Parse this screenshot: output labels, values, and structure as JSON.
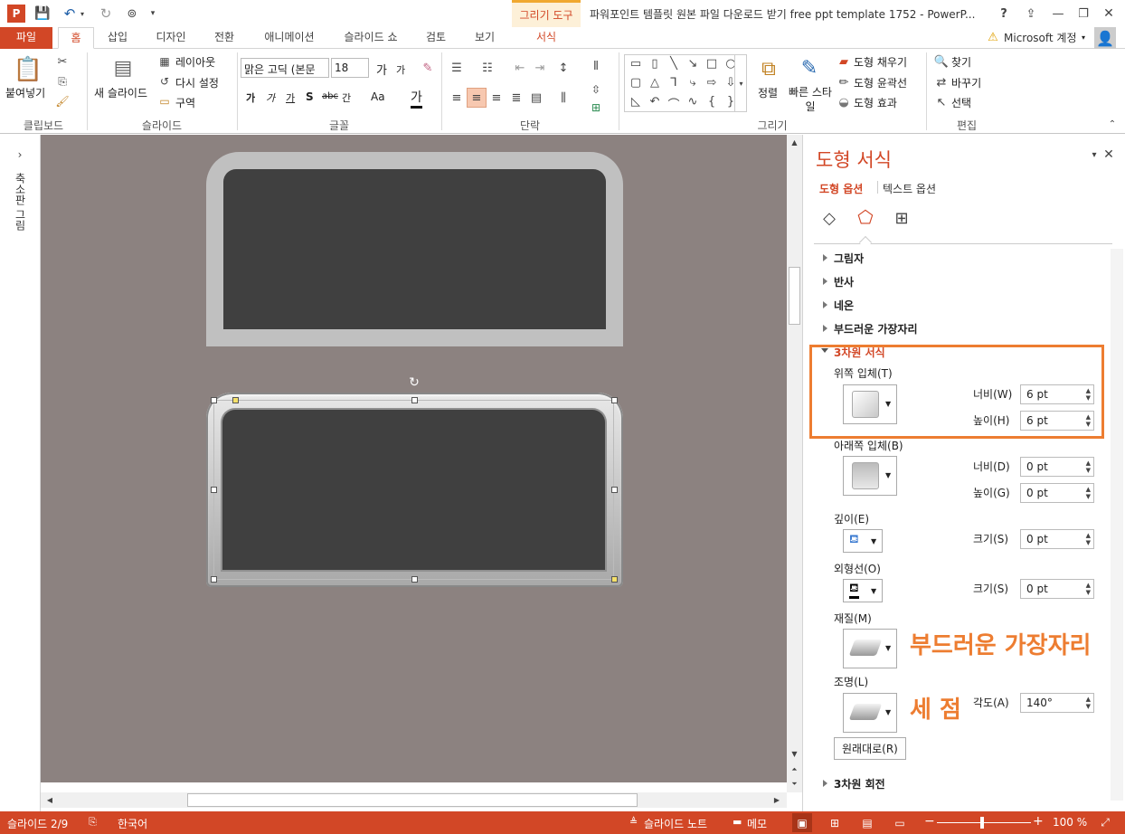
{
  "titlebar": {
    "contextual_group": "그리기 도구",
    "title": "파워포인트 템플릿 원본 파일 다운로드 받기 free ppt template 1752 - PowerP...",
    "help": "?",
    "controls": [
      "?",
      "⧉",
      "—",
      "❐",
      "✕"
    ]
  },
  "tabs": {
    "file": "파일",
    "home": "홈",
    "insert": "삽입",
    "design": "디자인",
    "transitions": "전환",
    "animations": "애니메이션",
    "slideshow": "슬라이드 쇼",
    "review": "검토",
    "view": "보기",
    "format": "서식",
    "account": "Microsoft 계정"
  },
  "ribbon": {
    "clipboard": {
      "paste": "붙여넣기",
      "label": "클립보드"
    },
    "slides": {
      "new_slide": "새 슬라이드",
      "layout": "레이아웃",
      "reset": "다시 설정",
      "section": "구역",
      "label": "슬라이드"
    },
    "font": {
      "family": "맑은 고딕 (본문",
      "size": "18",
      "grow": "가",
      "shrink": "가",
      "bold": "가",
      "italic": "가",
      "underline": "가",
      "shadow": "S",
      "strike": "abc",
      "spacing": "간",
      "case": "Aa",
      "color": "가",
      "label": "글꼴"
    },
    "paragraph": {
      "label": "단락"
    },
    "drawing": {
      "arrange": "정렬",
      "quick_styles": "빠른 스타일",
      "fill": "도형 채우기",
      "outline": "도형 윤곽선",
      "effects": "도형 효과",
      "label": "그리기"
    },
    "editing": {
      "find": "찾기",
      "replace": "바꾸기",
      "select": "선택",
      "label": "편집"
    }
  },
  "left_strip": {
    "label": "축소판 그림"
  },
  "pane": {
    "title": "도형 서식",
    "tab_shape": "도형 옵션",
    "tab_text": "텍스트 옵션",
    "sections": {
      "shadow": "그림자",
      "reflection": "반사",
      "glow": "네온",
      "soft_edges": "부드러운 가장자리",
      "format3d": "3차원 서식",
      "rotation3d": "3차원 회전"
    },
    "top_bevel": "위쪽 입체(T)",
    "bottom_bevel": "아래쪽 입체(B)",
    "width_top": "너비(W)",
    "height_top": "높이(H)",
    "width_top_val": "6 pt",
    "height_top_val": "6 pt",
    "width_bottom": "너비(D)",
    "height_bottom": "높이(G)",
    "width_bottom_val": "0 pt",
    "height_bottom_val": "0 pt",
    "depth": "깊이(E)",
    "depth_size": "크기(S)",
    "depth_size_val": "0 pt",
    "contour": "외형선(O)",
    "contour_size": "크기(S)",
    "contour_size_val": "0 pt",
    "material": "재질(M)",
    "lighting": "조명(L)",
    "angle": "각도(A)",
    "angle_val": "140°",
    "reset": "원래대로(R)",
    "annotation_material": "부드러운 가장자리",
    "annotation_lighting": "세 점",
    "accent": "#d24726",
    "highlight": "#ed7d31"
  },
  "status": {
    "slide": "슬라이드 2/9",
    "language": "한국어",
    "notes": "슬라이드 노트",
    "comments": "메모",
    "zoom": "100 %"
  }
}
